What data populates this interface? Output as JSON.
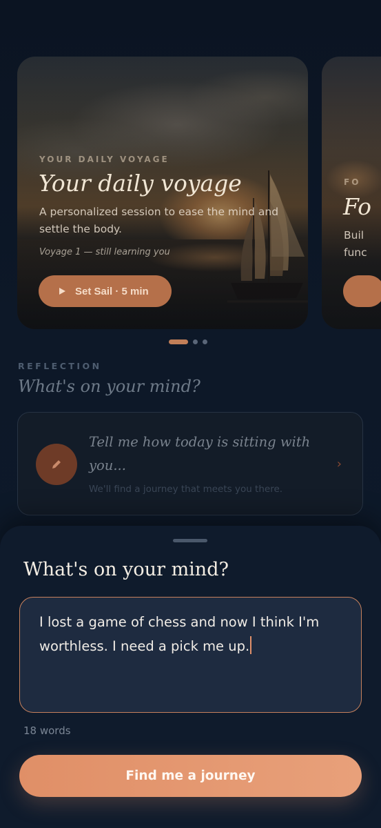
{
  "carousel": {
    "cards": [
      {
        "eyebrow": "YOUR DAILY VOYAGE",
        "title": "Your daily voyage",
        "description": "A personalized session to ease the mind and settle the body.",
        "meta": "Voyage 1 — still learning you",
        "cta_label": "Set Sail · 5 min",
        "cta_icon": "play-icon"
      },
      {
        "eyebrow": "FO",
        "title": "Fo",
        "description_line1": "Buil",
        "description_line2": "func"
      }
    ],
    "page_count": 3,
    "active_page": 1
  },
  "reflection": {
    "eyebrow": "REFLECTION",
    "title": "What's on your mind?",
    "prompt_title": "Tell me how today is sitting with you...",
    "prompt_subtitle": "We'll find a journey that meets you there.",
    "prompt_icon": "pencil-icon",
    "chevron_icon": "chevron-right-icon"
  },
  "sheet": {
    "title": "What's on your mind?",
    "input_value": "I lost a game of chess and now I think I'm worthless. I need a pick me up.",
    "word_count": "18 words",
    "primary_button": "Find me a journey"
  },
  "colors": {
    "accent": "#E08F67",
    "background": "#0B1422",
    "sheet": "#0F1B2C"
  }
}
